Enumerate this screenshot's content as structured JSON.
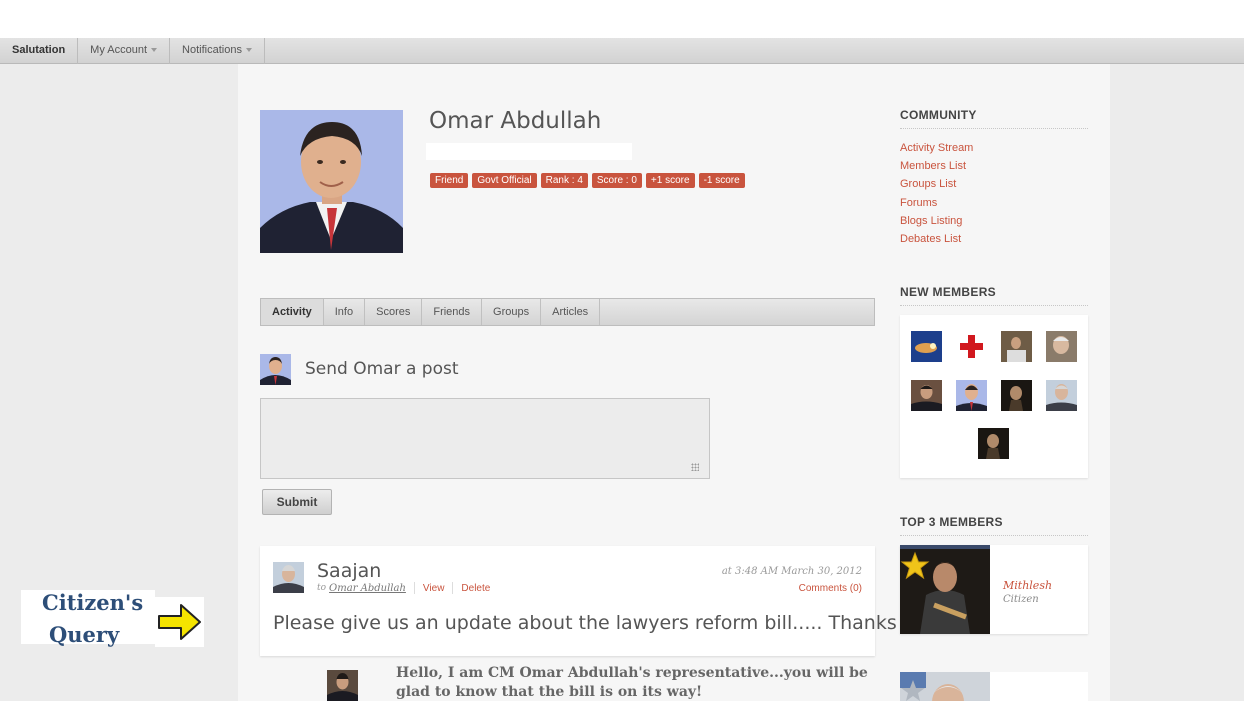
{
  "topbar": {
    "items": [
      {
        "label": "Salutation"
      },
      {
        "label": "My Account"
      },
      {
        "label": "Notifications"
      }
    ]
  },
  "profile": {
    "name": "Omar Abdullah",
    "badges": [
      "Friend",
      "Govt Official",
      "Rank : 4",
      "Score : 0",
      "+1 score",
      "-1 score"
    ]
  },
  "tabs": [
    "Activity",
    "Info",
    "Scores",
    "Friends",
    "Groups",
    "Articles"
  ],
  "post_box": {
    "title": "Send Omar a post",
    "submit_label": "Submit"
  },
  "activity": {
    "author": "Saajan",
    "to_prefix": "to",
    "target": "Omar Abdullah",
    "view_label": "View",
    "delete_label": "Delete",
    "timestamp": "at 3:48 AM March 30, 2012",
    "comments_label": "Comments (0)",
    "message": "Please give us an update about the lawyers reform bill..... Thanks"
  },
  "reply": {
    "text": "Hello, I am CM Omar Abdullah's representative...you will be glad to know that the bill is on its way!"
  },
  "annotation": {
    "line1": "Citizen's",
    "line2": "Query",
    "arrow_color": "#f5e400"
  },
  "sidebar": {
    "community_heading": "COMMUNITY",
    "community_links": [
      "Activity Stream",
      "Members List",
      "Groups List",
      "Forums",
      "Blogs Listing",
      "Debates List"
    ],
    "new_members_heading": "NEW MEMBERS",
    "top_members_heading": "TOP 3 MEMBERS",
    "top_member": {
      "name": "Mithlesh",
      "role": "Citizen"
    }
  },
  "colors": {
    "accent": "#c9543e",
    "annotation_text": "#2d4e78"
  }
}
